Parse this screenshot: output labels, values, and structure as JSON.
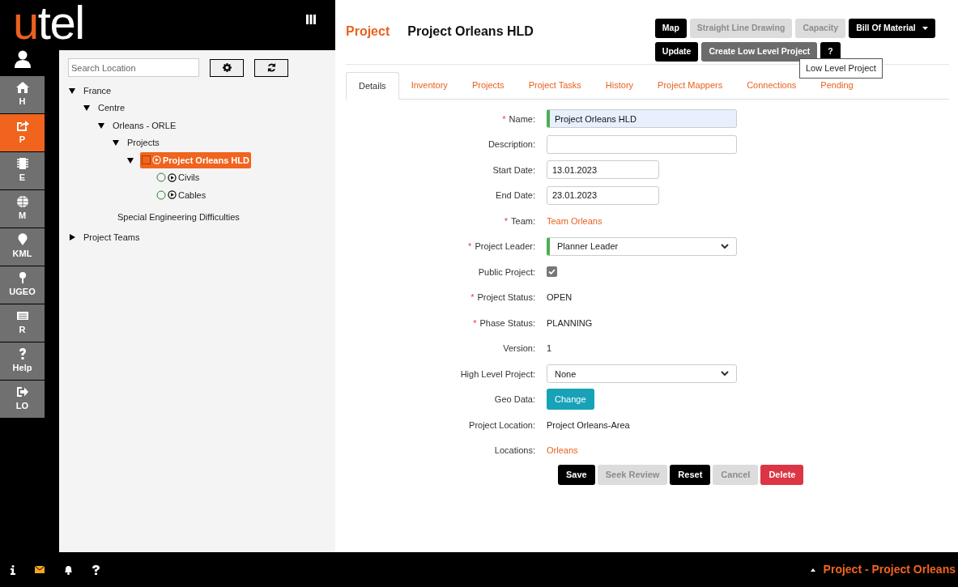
{
  "logo": {
    "accent": "u",
    "rest": "tel"
  },
  "nav": [
    {
      "label": "H",
      "selected": false
    },
    {
      "label": "P",
      "selected": true
    },
    {
      "label": "E",
      "selected": false
    },
    {
      "label": "M",
      "selected": false
    },
    {
      "label": "KML",
      "selected": false
    },
    {
      "label": "UGEO",
      "selected": false
    },
    {
      "label": "R",
      "selected": false
    },
    {
      "label": "Help",
      "selected": false
    },
    {
      "label": "LO",
      "selected": false
    }
  ],
  "tree": {
    "search": {
      "placeholder": "Search Location"
    },
    "nodes": [
      {
        "label": "France",
        "kind": "folder",
        "expanded": true,
        "selected": false,
        "children": [
          {
            "label": "Centre",
            "kind": "folder",
            "expanded": true,
            "selected": false,
            "children": [
              {
                "label": "Orleans - ORLE",
                "kind": "folder",
                "expanded": true,
                "selected": false,
                "children": [
                  {
                    "label": "Projects",
                    "kind": "folder",
                    "expanded": true,
                    "selected": false,
                    "children": [
                      {
                        "label": "Project Orleans HLD",
                        "kind": "project",
                        "expanded": true,
                        "selected": true,
                        "children": [
                          {
                            "label": "Civils",
                            "kind": "task",
                            "selected": false
                          },
                          {
                            "label": "Cables",
                            "kind": "task",
                            "selected": false
                          }
                        ]
                      }
                    ]
                  },
                  {
                    "label": "Special Engineering Difficulties",
                    "kind": "plain",
                    "selected": false
                  }
                ]
              }
            ]
          }
        ]
      },
      {
        "label": "Project Teams",
        "kind": "folder",
        "expanded": false,
        "selected": false
      }
    ]
  },
  "header": {
    "section": "Project",
    "title": "Project Orleans HLD"
  },
  "actions": [
    [
      {
        "label": "Map",
        "kind": "button",
        "disabled": false
      },
      {
        "label": "Straight Line Drawing",
        "kind": "button",
        "disabled": true
      },
      {
        "label": "Capacity",
        "kind": "button",
        "disabled": true
      },
      {
        "label": "Bill Of Material",
        "kind": "dropdown",
        "disabled": false
      }
    ],
    [
      {
        "label": "Update",
        "kind": "button",
        "disabled": false
      },
      {
        "label": "Create Low Level Project",
        "kind": "button",
        "disabled": false,
        "hovered": true
      },
      {
        "label": "?",
        "kind": "button",
        "disabled": false
      }
    ]
  ],
  "tooltip": "Low Level Project",
  "tabs": [
    {
      "label": "Details",
      "selected": true
    },
    {
      "label": "Inventory",
      "selected": false
    },
    {
      "label": "Projects",
      "selected": false
    },
    {
      "label": "Project Tasks",
      "selected": false
    },
    {
      "label": "History",
      "selected": false
    },
    {
      "label": "Project Mappers",
      "selected": false
    },
    {
      "label": "Connections",
      "selected": false
    },
    {
      "label": "Pending",
      "selected": false
    }
  ],
  "form": [
    {
      "label": "Name:",
      "required_mark": "*",
      "kind": "input",
      "value": "Project Orleans HLD",
      "valid": true
    },
    {
      "label": "Description:",
      "kind": "input"
    },
    {
      "label": "Start Date:",
      "kind": "date",
      "value": "13.01.2023"
    },
    {
      "label": "End Date:",
      "kind": "date",
      "value": "23.01.2023"
    },
    {
      "label": "Team:",
      "required_mark": "*",
      "kind": "link",
      "value": "Team Orleans"
    },
    {
      "label": "Project Leader:",
      "required_mark": "*",
      "kind": "select",
      "value": "Planner Leader",
      "valid": true
    },
    {
      "label": "Public Project:",
      "kind": "checkbox",
      "checked": true
    },
    {
      "label": "Project Status:",
      "required_mark": "*",
      "kind": "text",
      "value": "OPEN"
    },
    {
      "label": "Phase Status:",
      "required_mark": "*",
      "kind": "text",
      "value": "PLANNING"
    },
    {
      "label": "Version:",
      "kind": "text",
      "value": "1"
    },
    {
      "label": "High Level Project:",
      "kind": "select",
      "value": "None"
    },
    {
      "label": "Geo Data:",
      "kind": "button",
      "value": "Change"
    },
    {
      "label": "Project Location:",
      "kind": "text",
      "value": "Project Orleans-Area"
    },
    {
      "label": "Locations:",
      "kind": "link",
      "value": "Orleans"
    }
  ],
  "form_buttons": [
    {
      "label": "Save",
      "kind": "standard",
      "disabled": false
    },
    {
      "label": "Seek Review",
      "kind": "standard",
      "disabled": true
    },
    {
      "label": "Reset",
      "kind": "standard",
      "disabled": false
    },
    {
      "label": "Cancel",
      "kind": "standard",
      "disabled": true
    },
    {
      "label": "Delete",
      "kind": "delete",
      "disabled": false
    }
  ],
  "bottom_icons": [
    {
      "unread": false
    },
    {
      "unread": true
    },
    {
      "unread": false
    },
    {
      "unread": false
    }
  ],
  "status_text": "Project - Project Orleans"
}
